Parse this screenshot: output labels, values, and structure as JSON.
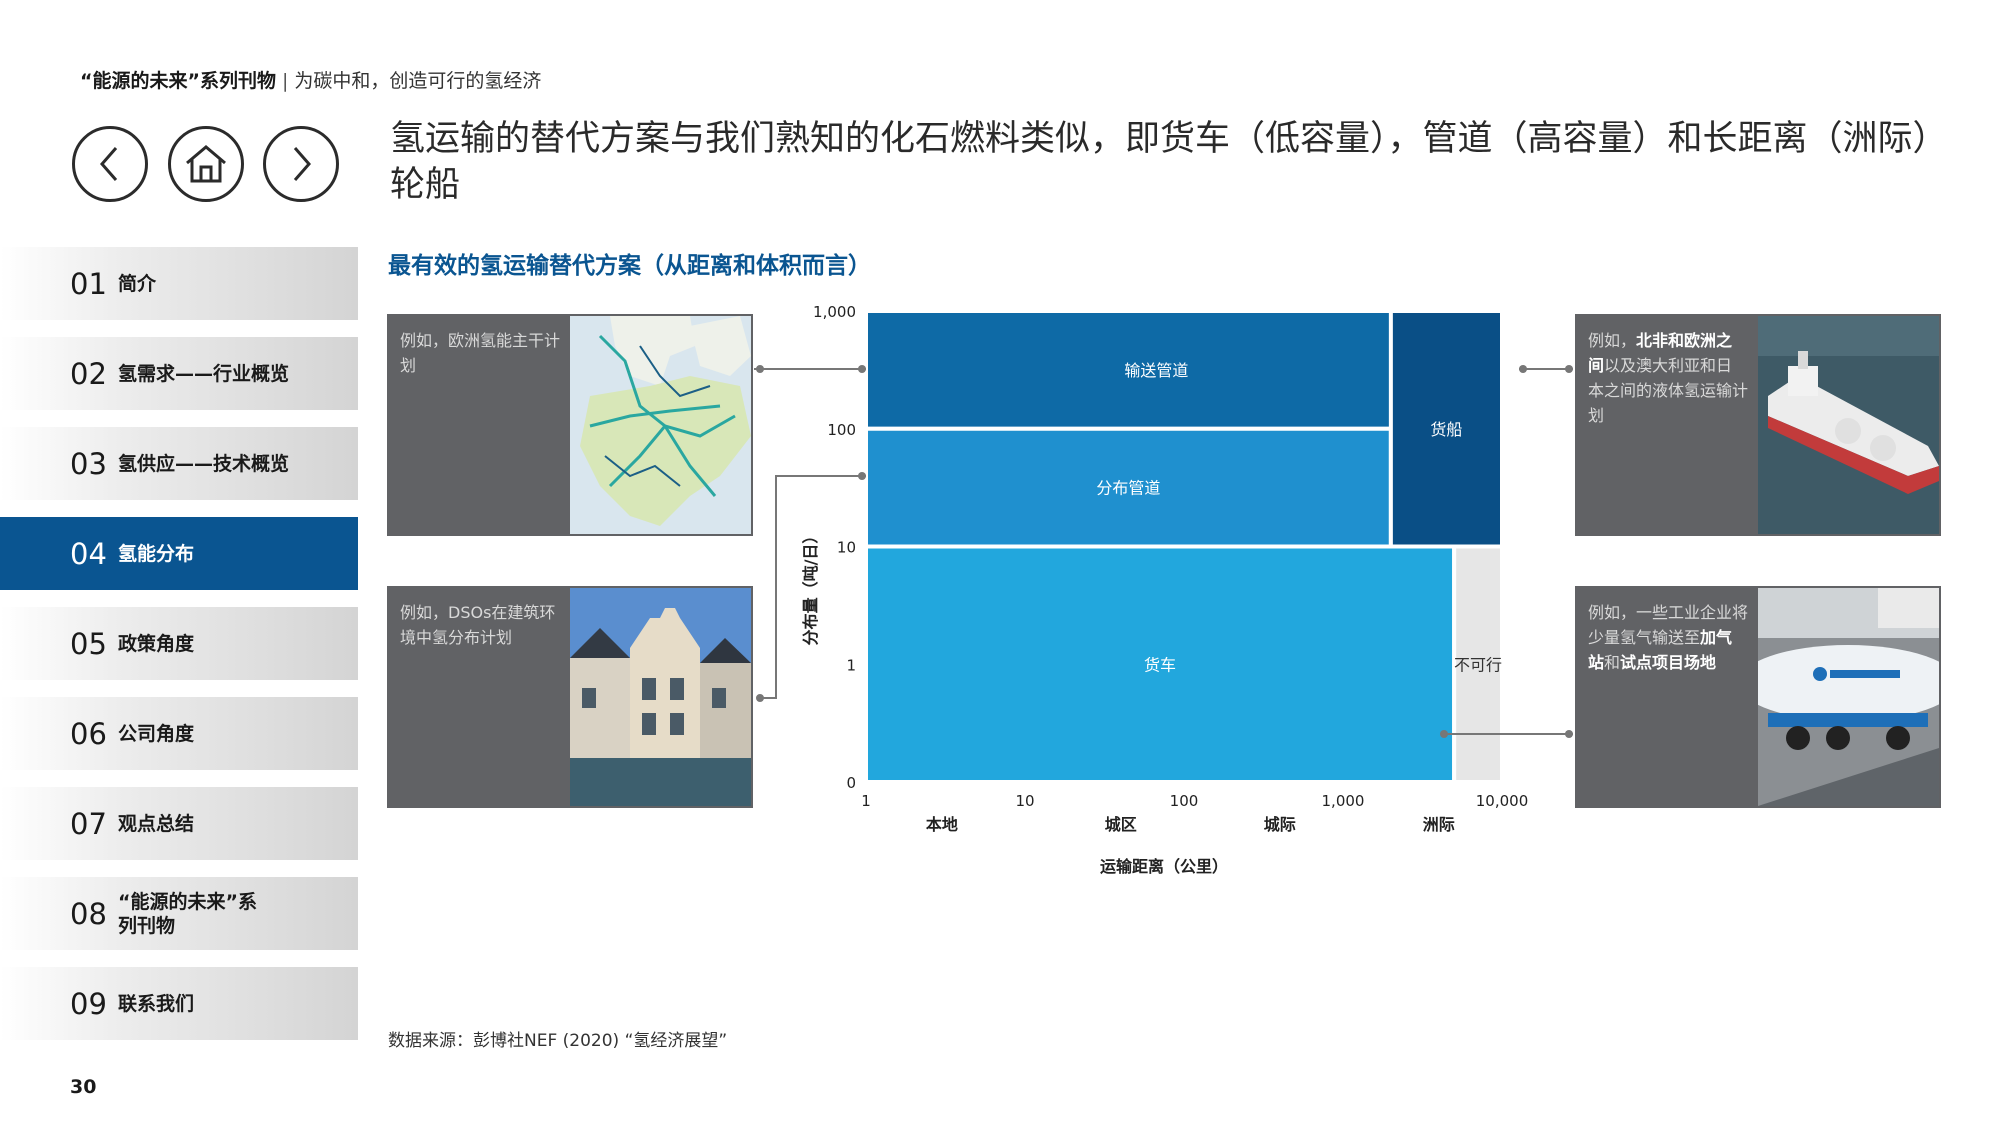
{
  "header": {
    "series": "“能源的未来”系列刊物",
    "separator": "|",
    "subtitle": "为碳中和，创造可行的氢经济"
  },
  "nav": {
    "back": "back-arrow-icon",
    "home": "home-icon",
    "forward": "forward-arrow-icon"
  },
  "headline": "氢运输的替代方案与我们熟知的化石燃料类似，即货车（低容量），管道（高容量）和长距离（洲际）轮船",
  "sidebar": {
    "items": [
      {
        "num": "01",
        "label": "简介"
      },
      {
        "num": "02",
        "label": "氢需求——行业概览"
      },
      {
        "num": "03",
        "label": "氢供应——技术概览"
      },
      {
        "num": "04",
        "label": "氢能分布"
      },
      {
        "num": "05",
        "label": "政策角度"
      },
      {
        "num": "06",
        "label": "公司角度"
      },
      {
        "num": "07",
        "label": "观点总结"
      },
      {
        "num": "08",
        "label": "“能源的未来”系列刊物"
      },
      {
        "num": "09",
        "label": "联系我们"
      }
    ],
    "active_index": 3
  },
  "callouts": {
    "europe": {
      "text": "例如，欧洲氢能主干计划"
    },
    "dso": {
      "text": "例如，DSOs在建筑环境中氢分布计划"
    },
    "ship": {
      "b1": "北非和欧洲之间",
      "pre": "例如，",
      "mid": "以及澳大利亚和日本之间的液体氢运输计划"
    },
    "industry": {
      "pre": "例如，一些工业企业将少量氢气输送至",
      "b1": "加气站",
      "mid": "和",
      "b2": "试点项目场地"
    }
  },
  "chart_title": "最有效的氢运输替代方案（从距离和体积而言）",
  "chart_data": {
    "type": "area",
    "xlabel": "运输距离（公里）",
    "ylabel": "分布量（吨/日）",
    "x_scale": "log",
    "x_ticks": [
      "1",
      "10",
      "100",
      "1,000",
      "10,000"
    ],
    "x_tick_values": [
      1,
      10,
      100,
      1000,
      10000
    ],
    "x_categories": [
      {
        "label": "本地",
        "x": 3
      },
      {
        "label": "城区",
        "x": 40
      },
      {
        "label": "城际",
        "x": 400
      },
      {
        "label": "洲际",
        "x": 4000
      }
    ],
    "y_ticks": [
      "0",
      "1",
      "10",
      "100",
      "1,000"
    ],
    "y_levels": [
      0,
      1,
      2,
      3,
      4
    ],
    "regions": [
      {
        "name": "输送管道",
        "x": [
          1,
          4500
        ],
        "y": [
          3,
          4
        ],
        "color": "#0e6aa6"
      },
      {
        "name": "分布管道",
        "x": [
          1,
          2000
        ],
        "y": [
          2,
          3
        ],
        "color": "#1f90cf"
      },
      {
        "name": "货船",
        "x": [
          2000,
          10000
        ],
        "y": [
          2,
          4
        ],
        "color": "#0a4f86"
      },
      {
        "name": "货车",
        "x": [
          1,
          5000
        ],
        "y": [
          0,
          2
        ],
        "color": "#22a7dd"
      },
      {
        "name": "不可行",
        "x": [
          5000,
          10000
        ],
        "y": [
          0,
          2
        ],
        "color": "#e6e6e6"
      }
    ]
  },
  "source": "数据来源：彭博社NEF (2020) “氢经济展望”",
  "page_number": "30"
}
